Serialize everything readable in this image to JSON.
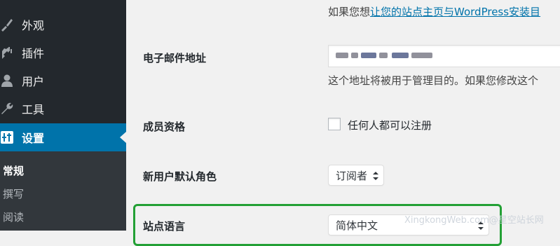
{
  "sidebar": {
    "items": [
      {
        "label": "外观",
        "icon": "brush-icon"
      },
      {
        "label": "插件",
        "icon": "plugin-icon"
      },
      {
        "label": "用户",
        "icon": "user-icon"
      },
      {
        "label": "工具",
        "icon": "wrench-icon"
      },
      {
        "label": "设置",
        "icon": "settings-icon",
        "active": true
      }
    ],
    "submenu": [
      {
        "label": "常规",
        "current": true
      },
      {
        "label": "撰写"
      },
      {
        "label": "阅读"
      }
    ]
  },
  "main": {
    "top_note_prefix": "如果您想",
    "top_note_link": "让您的站点主页与WordPress安装目",
    "email": {
      "label": "电子邮件地址",
      "help": "这个地址将被用于管理目的。如果您修改这个"
    },
    "membership": {
      "label": "成员资格",
      "checkbox_label": "任何人都可以注册"
    },
    "default_role": {
      "label": "新用户默认角色",
      "value": "订阅者"
    },
    "site_language": {
      "label": "站点语言",
      "value": "简体中文"
    }
  },
  "watermark": "XingkongWeb.com@星空站长网",
  "colors": {
    "sidebar_bg": "#23282d",
    "active_bg": "#0073aa",
    "link": "#0073aa",
    "highlight_border": "#23a035"
  }
}
